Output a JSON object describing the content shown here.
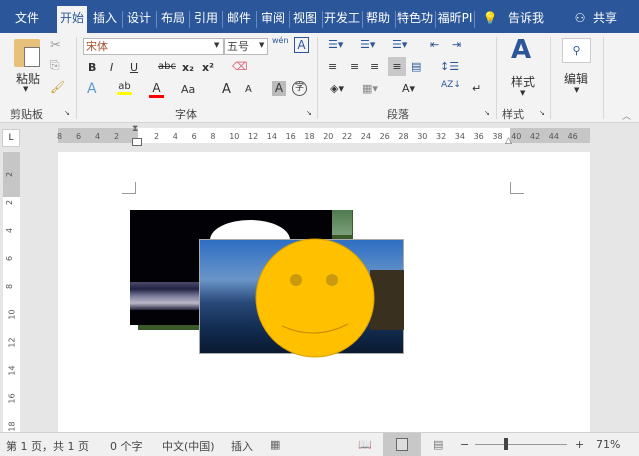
{
  "tabs": [
    "文件",
    "开始",
    "插入",
    "设计",
    "布局",
    "引用",
    "邮件",
    "审阅",
    "视图",
    "开发工",
    "帮助",
    "特色功",
    "福昕PI"
  ],
  "tell_me": "告诉我",
  "share": "共享",
  "clipboard": {
    "paste": "粘贴",
    "group": "剪贴板"
  },
  "font": {
    "name": "宋体",
    "size": "五号",
    "group": "字体",
    "bold": "B",
    "italic": "I",
    "underline": "U",
    "strike": "abc",
    "sub": "x₂",
    "sup": "x²",
    "case": "Aa",
    "grow": "A",
    "shrink": "A",
    "wen": "wén"
  },
  "paragraph": {
    "group": "段落"
  },
  "styles": {
    "label": "样式",
    "group": "样式"
  },
  "editing": {
    "label": "编辑"
  },
  "ruler": {
    "numbers": [
      "8",
      "6",
      "4",
      "2",
      "2",
      "4",
      "6",
      "8",
      "10",
      "12",
      "14",
      "16",
      "18",
      "20",
      "22",
      "24",
      "26",
      "28",
      "30",
      "32",
      "34",
      "36",
      "38",
      "40",
      "42",
      "44",
      "46"
    ],
    "vnumbers": [
      "2",
      "2",
      "4",
      "6",
      "8",
      "10",
      "12",
      "14",
      "16",
      "18"
    ]
  },
  "status": {
    "page": "第 1 页，共 1 页",
    "words": "0 个字",
    "lang": "中文(中国)",
    "mode": "插入",
    "zoom": "71%",
    "zoom_level": 71
  },
  "colors": {
    "brand": "#2b579a",
    "highlight": "#ffff00",
    "font_color": "#ff0000",
    "smiley": "#ffc000"
  }
}
